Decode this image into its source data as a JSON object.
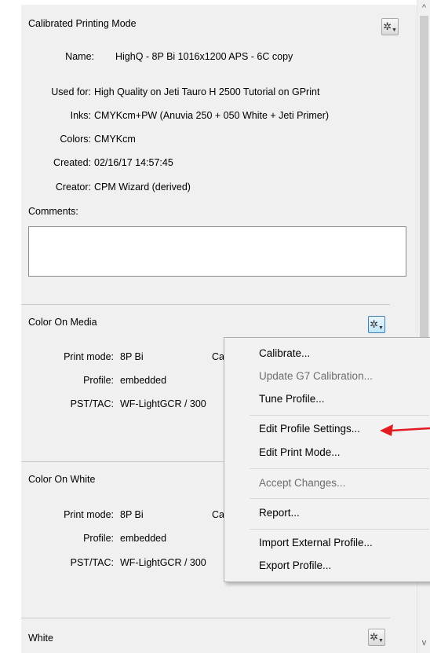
{
  "calibrated": {
    "title": "Calibrated Printing Mode",
    "name_label": "Name:",
    "name_value": "HighQ - 8P Bi 1016x1200 APS - 6C copy",
    "used_for_label": "Used for:",
    "used_for_value": "High Quality on Jeti Tauro H 2500 Tutorial on GPrint",
    "inks_label": "Inks:",
    "inks_value": "CMYKcm+PW (Anuvia 250 + 050 White + Jeti Primer)",
    "colors_label": "Colors:",
    "colors_value": "CMYKcm",
    "created_label": "Created:",
    "created_value": "02/16/17 14:57:45",
    "creator_label": "Creator:",
    "creator_value": "CPM Wizard (derived)",
    "comments_label": "Comments:",
    "comments_value": ""
  },
  "color_on_media": {
    "title": "Color On Media",
    "print_mode_label": "Print mode:",
    "print_mode_value": "8P Bi",
    "truncated": "Ca",
    "profile_label": "Profile:",
    "profile_value": "embedded",
    "pst_label": "PST/TAC:",
    "pst_value": "WF-LightGCR / 300"
  },
  "color_on_white": {
    "title": "Color On White",
    "print_mode_label": "Print mode:",
    "print_mode_value": "8P Bi",
    "truncated": "Ca",
    "profile_label": "Profile:",
    "profile_value": "embedded",
    "pst_label": "PST/TAC:",
    "pst_value": "WF-LightGCR / 300"
  },
  "white": {
    "title": "White"
  },
  "menu": {
    "calibrate": "Calibrate...",
    "update_g7": "Update G7 Calibration...",
    "tune_profile": "Tune Profile...",
    "edit_profile_settings": "Edit Profile Settings...",
    "edit_print_mode": "Edit Print Mode...",
    "accept_changes": "Accept Changes...",
    "report": "Report...",
    "import_external": "Import External Profile...",
    "export_profile": "Export Profile..."
  },
  "icons": {
    "gear": "gear-icon",
    "arrow": "red-arrow-annotation",
    "scroll_up": "chevron-up-icon",
    "scroll_down": "chevron-down-icon"
  },
  "colors": {
    "annotation_arrow": "#e21b23",
    "menu_disabled": "#6d6d6d",
    "active_button": "#bee6fd"
  }
}
